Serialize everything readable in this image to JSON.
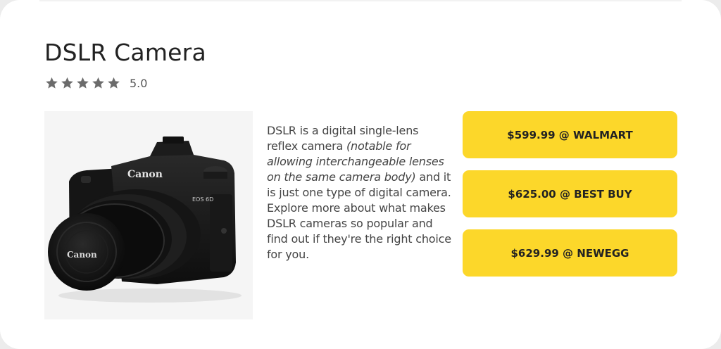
{
  "product": {
    "title": "DSLR Camera",
    "rating": {
      "stars": 5,
      "max_stars": 5,
      "value_label": "5.0",
      "star_color": "#6b6b6b",
      "icon": "star-icon"
    },
    "image": {
      "brand_text": "Canon",
      "model_text": "EOS 6D"
    },
    "description": {
      "part1": "DSLR is a digital single-lens reflex camera ",
      "italic": "(notable for allowing interchangeable lenses on the same camera body)",
      "part2": " and it is just one type of digital camera. Explore more about what makes DSLR cameras so popular and find out if they're the right choice for you."
    }
  },
  "offers": [
    {
      "label": "$599.99 @ WALMART"
    },
    {
      "label": "$625.00 @ BEST BUY"
    },
    {
      "label": "$629.99 @ NEWEGG"
    }
  ],
  "colors": {
    "button": "#fcd72a",
    "title": "#222222",
    "body_text": "#444444"
  }
}
